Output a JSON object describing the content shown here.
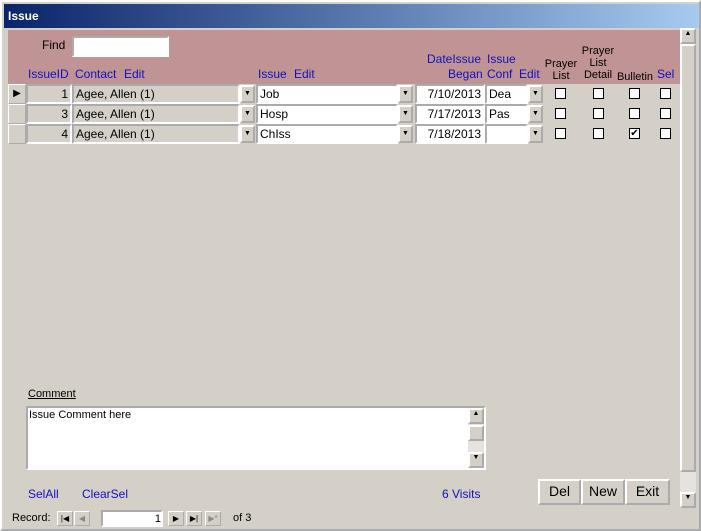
{
  "window": {
    "title": "Issue"
  },
  "find": {
    "label": "Find",
    "value": ""
  },
  "columns": {
    "issue_id": "IssueID",
    "contact": "Contact",
    "contact_edit": "Edit",
    "issue": "Issue",
    "issue_edit": "Edit",
    "date_l1": "DateIssue",
    "date_l2": "Began",
    "conf_l1": "Issue",
    "conf_l2": "Conf",
    "conf_edit": "Edit",
    "prayer_list": "Prayer List",
    "prayer_detail": "Prayer List Detail",
    "bulletin": "Bulletin",
    "sel": "Sel"
  },
  "rows": [
    {
      "id": "1",
      "contact": "Agee, Allen (1)",
      "issue": "Job",
      "date": "7/10/2013",
      "conf": "Dea",
      "prayer_list": false,
      "prayer_detail": false,
      "bulletin": false,
      "sel": false,
      "current": true
    },
    {
      "id": "3",
      "contact": "Agee, Allen (1)",
      "issue": "Hosp",
      "date": "7/17/2013",
      "conf": "Pas",
      "prayer_list": false,
      "prayer_detail": false,
      "bulletin": false,
      "sel": false,
      "current": false
    },
    {
      "id": "4",
      "contact": "Agee, Allen (1)",
      "issue": "ChIss",
      "date": "7/18/2013",
      "conf": "",
      "prayer_list": false,
      "prayer_detail": false,
      "bulletin": true,
      "sel": false,
      "current": false
    }
  ],
  "comment": {
    "label": "Comment",
    "value": "Issue Comment here"
  },
  "footer": {
    "sel_all": "SelAll",
    "clear_sel": "ClearSel",
    "visits": "6 Visits",
    "del": "Del",
    "new": "New",
    "exit": "Exit"
  },
  "record_nav": {
    "label": "Record:",
    "current": "1",
    "of": "of 3"
  }
}
